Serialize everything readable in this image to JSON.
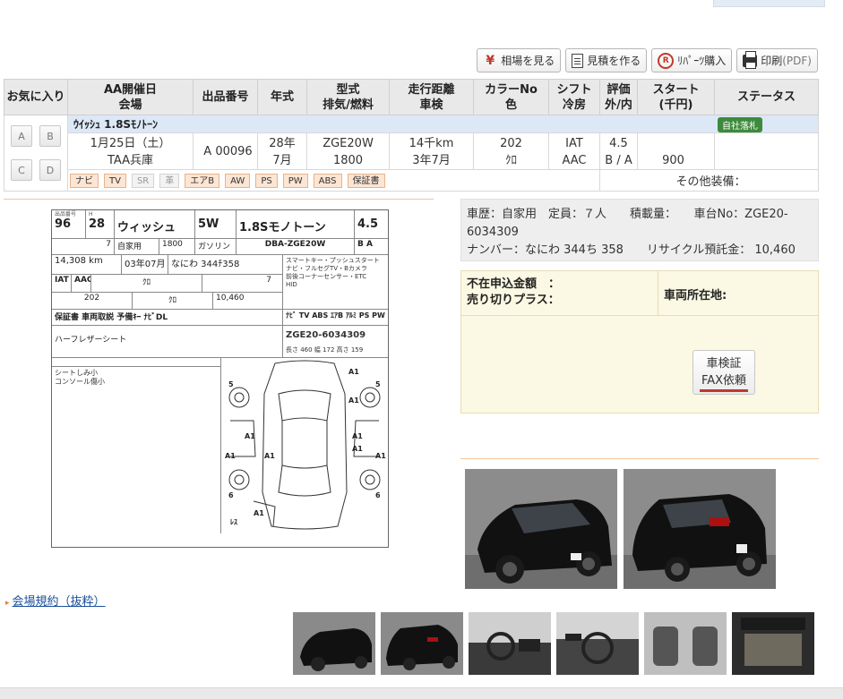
{
  "toolbar": {
    "market_label": "相場を見る",
    "estimate_label": "見積を作る",
    "parts_label": "ﾘﾊﾟｰﾂ購入",
    "print_label": "印刷",
    "print_suffix": "(PDF)",
    "yen_glyph": "¥",
    "ban_glyph": "R"
  },
  "table": {
    "headers": {
      "favorite": "お気に入り",
      "date_venue_1": "AA開催日",
      "date_venue_2": "会場",
      "lot": "出品番号",
      "year": "年式",
      "model_1": "型式",
      "model_2": "排気/燃料",
      "mileage_1": "走行距離",
      "mileage_2": "車検",
      "color_1": "カラーNo",
      "color_2": "色",
      "shift_1": "シフト",
      "shift_2": "冷房",
      "grade_1": "評価",
      "grade_2": "外/内",
      "start_1": "スタート",
      "start_2": "(千円)",
      "status": "ステータス"
    },
    "vehicle_name": "ｳｲｯｼｭ 1.8Sﾓﾉﾄｰﾝ",
    "status_badge": "自社落札",
    "fav_buttons": [
      "A",
      "B",
      "C",
      "D"
    ],
    "row": {
      "date": "1月25日（土）",
      "venue": "TAA兵庫",
      "lot": "A 00096",
      "year": "28年",
      "month": "7月",
      "model": "ZGE20W",
      "displacement": "1800",
      "mileage": "14千km",
      "inspection": "3年7月",
      "color_no": "202",
      "color": "ｸﾛ",
      "shift": "IAT",
      "ac": "AAC",
      "grade": "4.5",
      "grade_ext_int": "B / A",
      "start": "900"
    },
    "equipment": [
      "ナビ",
      "TV",
      "SR",
      "革",
      "エアB",
      "AW",
      "PS",
      "PW",
      "ABS",
      "保証書"
    ],
    "other_equipment": "その他装備："
  },
  "sheet": {
    "lot_label": "出品番号",
    "lot": "96",
    "era": "H",
    "year": "28",
    "month": "7",
    "name": "ウィッシュ",
    "doors": "5W",
    "grade": "1.8Sモノトーン",
    "score": "4.5",
    "score_sub": "B A",
    "usage": "自家用",
    "cc": "1800",
    "fuel": "ガソリン",
    "model": "DBA-ZGE20W",
    "mileage": "14,308 km",
    "inspection": "03年07月",
    "plate": "なにわ 344ﾁ358",
    "shift": "IAT",
    "ac": "AAC",
    "color": "ｸﾛ",
    "color_code": "202",
    "color_int": "ｸﾛ",
    "seats": "7",
    "recycle": "10,460",
    "sales_points": [
      "スマートキー・プッシュスタート",
      "ナビ・フルセグTV・Bカメラ",
      "前後コーナーセンサー・ETC",
      "HID"
    ],
    "equip_line": "保証書 車両取説 予備ｷｰ ﾅﾋﾞDL",
    "equip_codes": "ﾅﾋﾞ TV ABS ｴｱB ｱﾙﾐ PS PW",
    "notes": "ハーフレザーシート",
    "chassis": "ZGE20-6034309",
    "dims": "長さ 460 幅 172 高さ 159",
    "inspector_notes": [
      "シートしみ小",
      "コンソール傷小"
    ],
    "damage_marks": [
      "A1",
      "A1",
      "A1",
      "A1",
      "A1",
      "A1",
      "A1",
      "A1",
      "A1",
      "5",
      "5",
      "6",
      "6",
      "ﾚｽ"
    ]
  },
  "info": {
    "line1": "車歴：自家用　定員：７人　　積載量：　　車台No：ZGE20-",
    "line2": "6034309",
    "line3": "ナンバー：なにわ 344ち 358　　リサイクル預託金： 10,460"
  },
  "box": {
    "absent_bid": "不在申込金額　：",
    "sell_plus": "売り切りプラス：",
    "location": "車両所在地:",
    "fax_line1": "車検証",
    "fax_line2": "FAX依頼"
  },
  "rules_link": "会場規約（抜粋）"
}
